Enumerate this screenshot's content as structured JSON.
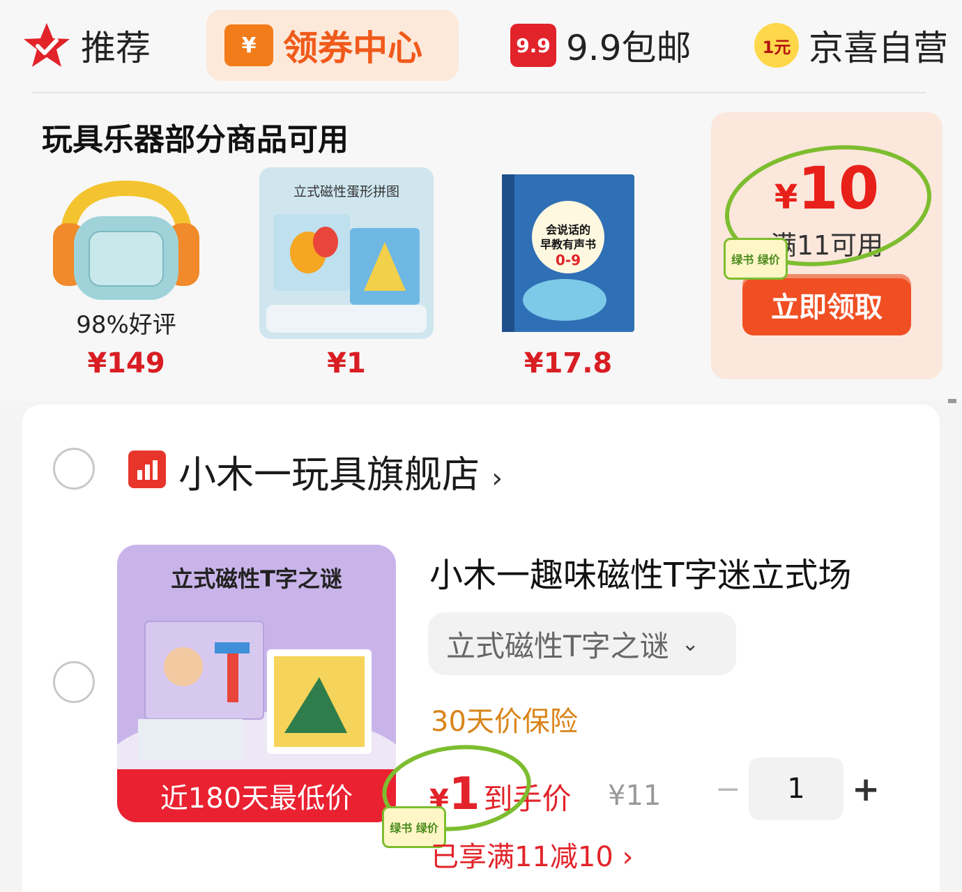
{
  "nav": {
    "tabs": [
      {
        "label": "推荐"
      },
      {
        "label": "领券中心",
        "icon_text": "¥"
      },
      {
        "label": "9.9包邮",
        "icon_text": "9.9"
      },
      {
        "label": "京喜自营",
        "icon_text": "1元"
      }
    ]
  },
  "promo": {
    "title": "玩具乐器部分商品可用",
    "products": [
      {
        "tag": "98%好评",
        "price": "¥149"
      },
      {
        "caption": "立式磁性蛋形拼图",
        "price": "¥1"
      },
      {
        "caption": "会说话的早教有声书 0-9",
        "price": "¥17.8"
      }
    ],
    "coupon": {
      "currency": "¥",
      "amount": "10",
      "condition": "满11可用",
      "button": "立即领取"
    }
  },
  "cart": {
    "shop_name": "小木一玩具旗舰店",
    "shop_chevron": "›",
    "item": {
      "image_caption": "立式磁性T字之谜",
      "image_banner": "近180天最低价",
      "title": "小木一趣味磁性T字迷立式场",
      "spec": "立式磁性T字之谜",
      "insurance": "30天价保险",
      "final_currency": "¥",
      "final_amount": "1",
      "final_label": "到手价",
      "original_price": "¥11",
      "quantity": "1",
      "discount": "已享满11减10 ›"
    }
  },
  "stickers": {
    "text": "绿书 绿价"
  },
  "colors": {
    "accent_red": "#e2232a",
    "coupon_orange": "#f04f23",
    "insurance": "#d9851a",
    "highlight_circle": "#7dbd2f"
  }
}
